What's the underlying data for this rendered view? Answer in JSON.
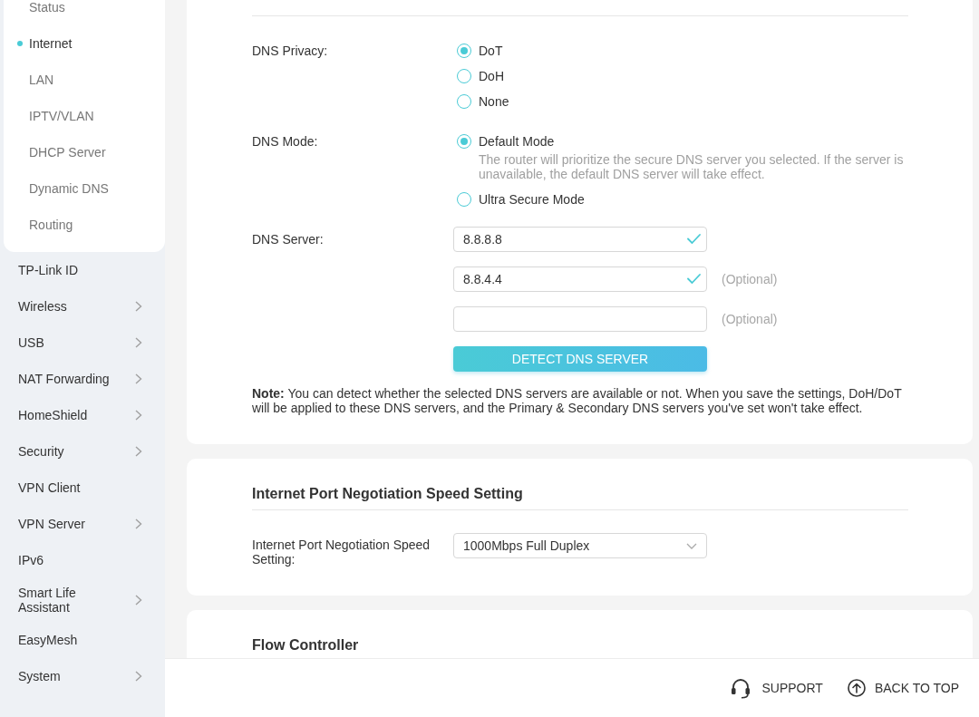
{
  "sidebar": {
    "submenu": [
      {
        "label": "Status",
        "selected": false
      },
      {
        "label": "Internet",
        "selected": true
      },
      {
        "label": "LAN",
        "selected": false
      },
      {
        "label": "IPTV/VLAN",
        "selected": false
      },
      {
        "label": "DHCP Server",
        "selected": false
      },
      {
        "label": "Dynamic DNS",
        "selected": false
      },
      {
        "label": "Routing",
        "selected": false
      }
    ],
    "items": [
      {
        "label": "TP-Link ID",
        "expandable": false
      },
      {
        "label": "Wireless",
        "expandable": true
      },
      {
        "label": "USB",
        "expandable": true
      },
      {
        "label": "NAT Forwarding",
        "expandable": true
      },
      {
        "label": "HomeShield",
        "expandable": true
      },
      {
        "label": "Security",
        "expandable": true
      },
      {
        "label": "VPN Client",
        "expandable": false
      },
      {
        "label": "VPN Server",
        "expandable": true
      },
      {
        "label": "IPv6",
        "expandable": false
      },
      {
        "label": "Smart Life Assistant",
        "expandable": true
      },
      {
        "label": "EasyMesh",
        "expandable": false
      },
      {
        "label": "System",
        "expandable": true
      }
    ]
  },
  "dns": {
    "privacy": {
      "label": "DNS Privacy:",
      "options": [
        {
          "label": "DoT",
          "selected": true
        },
        {
          "label": "DoH",
          "selected": false
        },
        {
          "label": "None",
          "selected": false
        }
      ]
    },
    "mode": {
      "label": "DNS Mode:",
      "options": [
        {
          "label": "Default Mode",
          "selected": true,
          "description": "The router will prioritize the secure DNS server you selected. If the server is unavailable, the default DNS server will take effect."
        },
        {
          "label": "Ultra Secure Mode",
          "selected": false
        }
      ]
    },
    "server": {
      "label": "DNS Server:",
      "fields": [
        {
          "value": "8.8.8.8",
          "valid": true
        },
        {
          "value": "8.8.4.4",
          "valid": true,
          "hint": "(Optional)"
        },
        {
          "valid": false,
          "hint": "(Optional)"
        }
      ]
    },
    "detect_button": "DETECT DNS SERVER",
    "note": "**Note:** You can detect whether the selected DNS servers are available or not. When you save the settings, DoH/DoT will be applied to these DNS servers, and the Primary & Secondary DNS servers you've set won't take effect."
  },
  "port_speed": {
    "title": "Internet Port Negotiation Speed Setting",
    "label": "Internet Port Negotiation Speed Setting:",
    "value": "1000Mbps Full Duplex"
  },
  "flow_controller": {
    "title": "Flow Controller"
  },
  "footer": {
    "links": [
      {
        "kind": "support",
        "label": "SUPPORT"
      },
      {
        "kind": "back_to_top",
        "label": "BACK TO TOP"
      }
    ]
  }
}
